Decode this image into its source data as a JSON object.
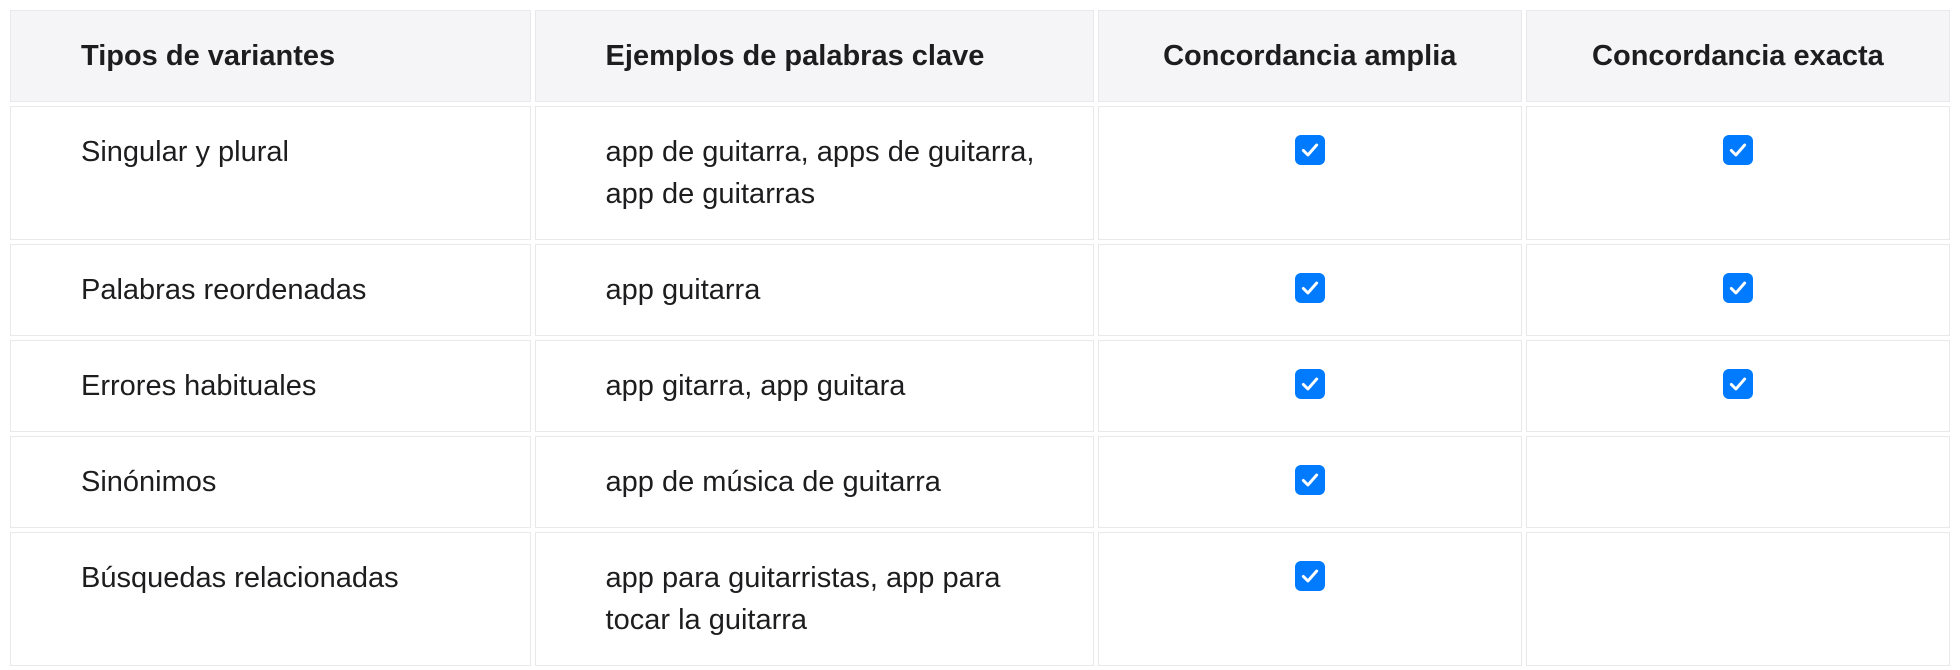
{
  "headers": {
    "variant_types": "Tipos de variantes",
    "keyword_examples": "Ejemplos de palabras clave",
    "broad_match": "Concordancia amplia",
    "exact_match": "Concordancia exacta"
  },
  "rows": [
    {
      "type": "Singular y plural",
      "example": "app de guitarra, apps de guitarra, app de guitarras",
      "broad": true,
      "exact": true
    },
    {
      "type": "Palabras reordenadas",
      "example": "app guitarra",
      "broad": true,
      "exact": true
    },
    {
      "type": "Errores habituales",
      "example": "app gitarra, app guitara",
      "broad": true,
      "exact": true
    },
    {
      "type": "Sinónimos",
      "example": "app de música de guitarra",
      "broad": true,
      "exact": false
    },
    {
      "type": "Búsquedas relacionadas",
      "example": "app para guitarristas, app para tocar la guitarra",
      "broad": true,
      "exact": false
    }
  ],
  "icons": {
    "check": "check-icon"
  },
  "colors": {
    "accent": "#007aff",
    "header_bg": "#f5f5f7",
    "border": "#e9e9eb",
    "text": "#1d1d1f"
  },
  "chart_data": {
    "type": "table",
    "title": "",
    "columns": [
      "Tipos de variantes",
      "Ejemplos de palabras clave",
      "Concordancia amplia",
      "Concordancia exacta"
    ],
    "rows": [
      [
        "Singular y plural",
        "app de guitarra, apps de guitarra, app de guitarras",
        true,
        true
      ],
      [
        "Palabras reordenadas",
        "app guitarra",
        true,
        true
      ],
      [
        "Errores habituales",
        "app gitarra, app guitara",
        true,
        true
      ],
      [
        "Sinónimos",
        "app de música de guitarra",
        true,
        false
      ],
      [
        "Búsquedas relacionadas",
        "app para guitarristas, app para tocar la guitarra",
        true,
        false
      ]
    ]
  }
}
